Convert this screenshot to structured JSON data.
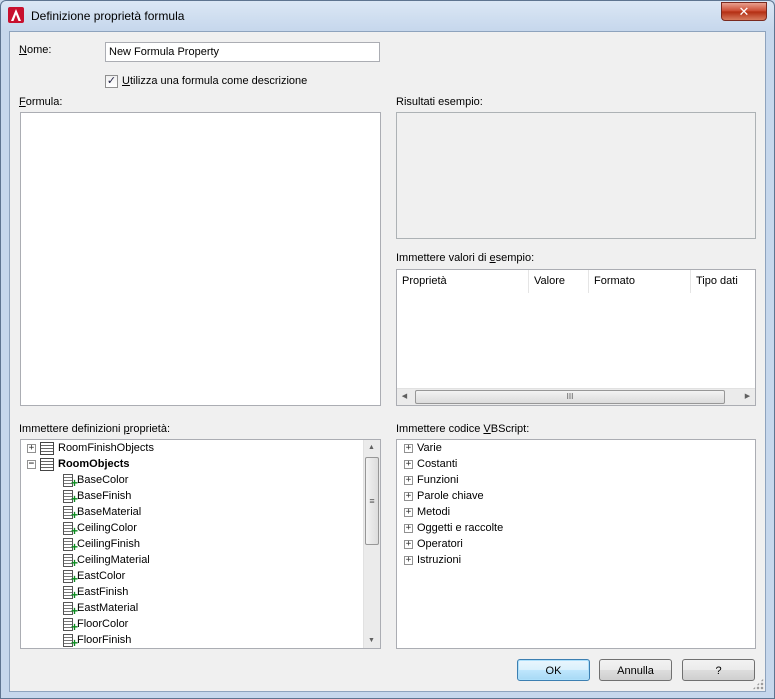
{
  "window": {
    "title": "Definizione proprietà formula",
    "close_label": "✕"
  },
  "name": {
    "label_first": "N",
    "label_rest": "ome:",
    "value": "New Formula Property"
  },
  "use_formula_checkbox": {
    "label_first": "U",
    "label_rest": "tilizza una formula come descrizione",
    "checked": true,
    "mark": "✓"
  },
  "formula": {
    "label_first": "F",
    "label_rest": "ormula:"
  },
  "sample_results": {
    "label": "Risultati esempio:"
  },
  "sample_values": {
    "label_pre": "Immettere valori di ",
    "label_u": "e",
    "label_post": "sempio:",
    "columns": [
      "Proprietà",
      "Valore",
      "Formato",
      "Tipo dati"
    ]
  },
  "property_definitions": {
    "label_pre": "Immettere definizioni ",
    "label_u": "p",
    "label_post": "roprietà:",
    "items": [
      {
        "label": "RoomFinishObjects",
        "type": "table",
        "expander": "+"
      },
      {
        "label": "RoomObjects",
        "type": "table",
        "expander": "−"
      },
      {
        "label": "BaseColor",
        "type": "prop"
      },
      {
        "label": "BaseFinish",
        "type": "prop"
      },
      {
        "label": "BaseMaterial",
        "type": "prop"
      },
      {
        "label": "CeilingColor",
        "type": "prop"
      },
      {
        "label": "CeilingFinish",
        "type": "prop"
      },
      {
        "label": "CeilingMaterial",
        "type": "prop"
      },
      {
        "label": "EastColor",
        "type": "prop"
      },
      {
        "label": "EastFinish",
        "type": "prop"
      },
      {
        "label": "EastMaterial",
        "type": "prop"
      },
      {
        "label": "FloorColor",
        "type": "prop"
      },
      {
        "label": "FloorFinish",
        "type": "prop"
      }
    ]
  },
  "vbscript": {
    "label_pre": "Immettere codice ",
    "label_u": "V",
    "label_post": "BScript:",
    "items": [
      {
        "label": "Varie",
        "expander": "+"
      },
      {
        "label": "Costanti",
        "expander": "+"
      },
      {
        "label": "Funzioni",
        "expander": "+"
      },
      {
        "label": "Parole chiave",
        "expander": "+"
      },
      {
        "label": "Metodi",
        "expander": "+"
      },
      {
        "label": "Oggetti e raccolte",
        "expander": "+"
      },
      {
        "label": "Operatori",
        "expander": "+"
      },
      {
        "label": "Istruzioni",
        "expander": "+"
      }
    ]
  },
  "scroll": {
    "up": "▲",
    "down": "▼",
    "left": "◀",
    "right": "▶",
    "grip_v": "≡",
    "grip_h": "III"
  },
  "buttons": {
    "ok": "OK",
    "cancel": "Annulla",
    "help": "?"
  }
}
